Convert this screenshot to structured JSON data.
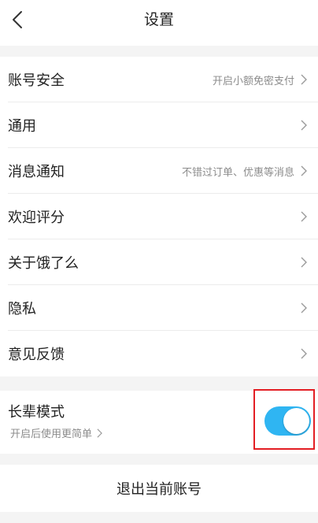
{
  "header": {
    "title": "设置",
    "back_icon": "chevron-left-icon"
  },
  "menu": {
    "items": [
      {
        "label": "账号安全",
        "value": "开启小额免密支付"
      },
      {
        "label": "通用",
        "value": ""
      },
      {
        "label": "消息通知",
        "value": "不错过订单、优惠等消息"
      },
      {
        "label": "欢迎评分",
        "value": ""
      },
      {
        "label": "关于饿了么",
        "value": ""
      },
      {
        "label": "隐私",
        "value": ""
      },
      {
        "label": "意见反馈",
        "value": ""
      }
    ]
  },
  "senior_mode": {
    "title": "长辈模式",
    "subtitle": "开启后使用更简单",
    "enabled": true
  },
  "logout": {
    "label": "退出当前账号"
  },
  "colors": {
    "toggle_on": "#2fb5f2",
    "highlight": "#e31e24"
  }
}
